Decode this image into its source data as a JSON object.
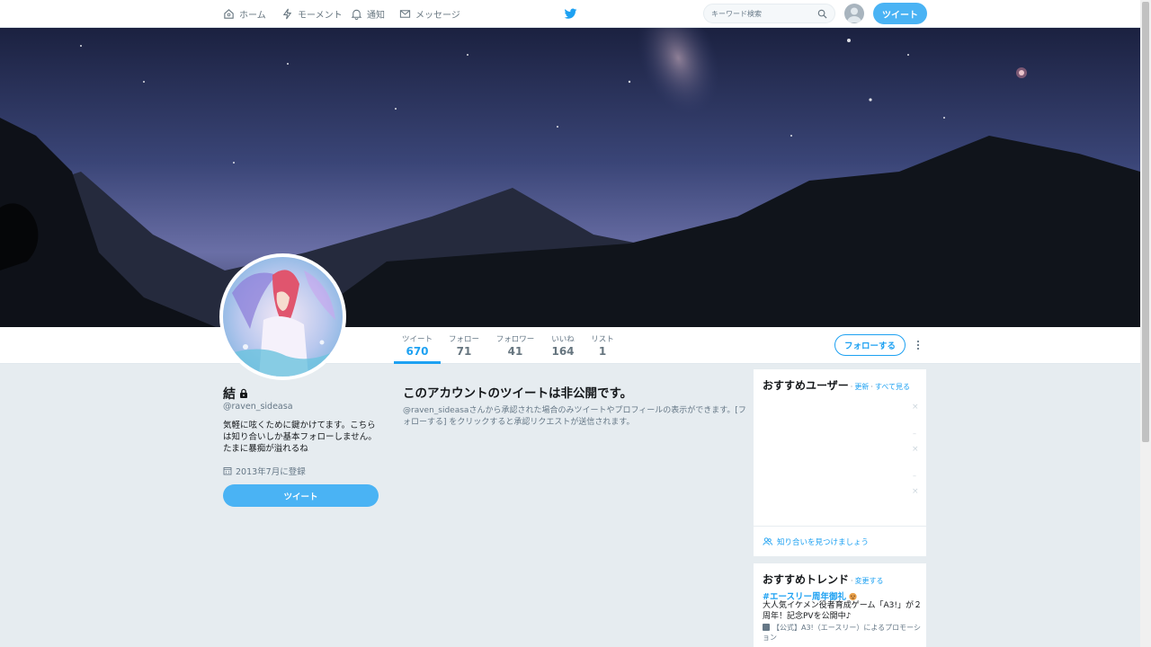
{
  "topnav": {
    "home": "ホーム",
    "moments": "モーメント",
    "notifications": "通知",
    "messages": "メッセージ",
    "search_placeholder": "キーワード検索",
    "tweet_button": "ツイート"
  },
  "profile": {
    "name": "結",
    "handle": "@raven_sideasa",
    "bio": "気軽に呟くために鍵かけてます。こちらは知り合いしか基本フォローしません。たまに暴痴が溢れるね",
    "joined": "2013年7月に登録",
    "tweet_button": "ツイート"
  },
  "stats": [
    {
      "label": "ツイート",
      "value": "670",
      "active": true
    },
    {
      "label": "フォロー",
      "value": "71"
    },
    {
      "label": "フォロワー",
      "value": "41"
    },
    {
      "label": "いいね",
      "value": "164"
    },
    {
      "label": "リスト",
      "value": "1"
    }
  ],
  "follow_button": "フォローする",
  "protected": {
    "title": "このアカウントのツイートは非公開です。",
    "body": "@raven_sideasaさんから承認された場合のみツイートやプロフィールの表示ができます。[フォローする] をクリックすると承認リクエストが送信されます。"
  },
  "who_to_follow": {
    "title": "おすすめユーザー",
    "refresh": "更新",
    "view_all": "すべて見る",
    "separator": "·",
    "footer_link": "知り合いを見つけましょう"
  },
  "trends": {
    "title": "おすすめトレンド",
    "change": "変更する",
    "separator": "·",
    "tag": "#エースリー周年御礼",
    "description": "大人気イケメン役者育成ゲーム「A3!」が２周年！記念PVを公開中♪",
    "promo": "【公式】A3!（エースリー）によるプロモーション"
  },
  "colors": {
    "accent": "#1da1f2",
    "button_fill": "#4ab3f4",
    "background": "#e6ecf0"
  }
}
